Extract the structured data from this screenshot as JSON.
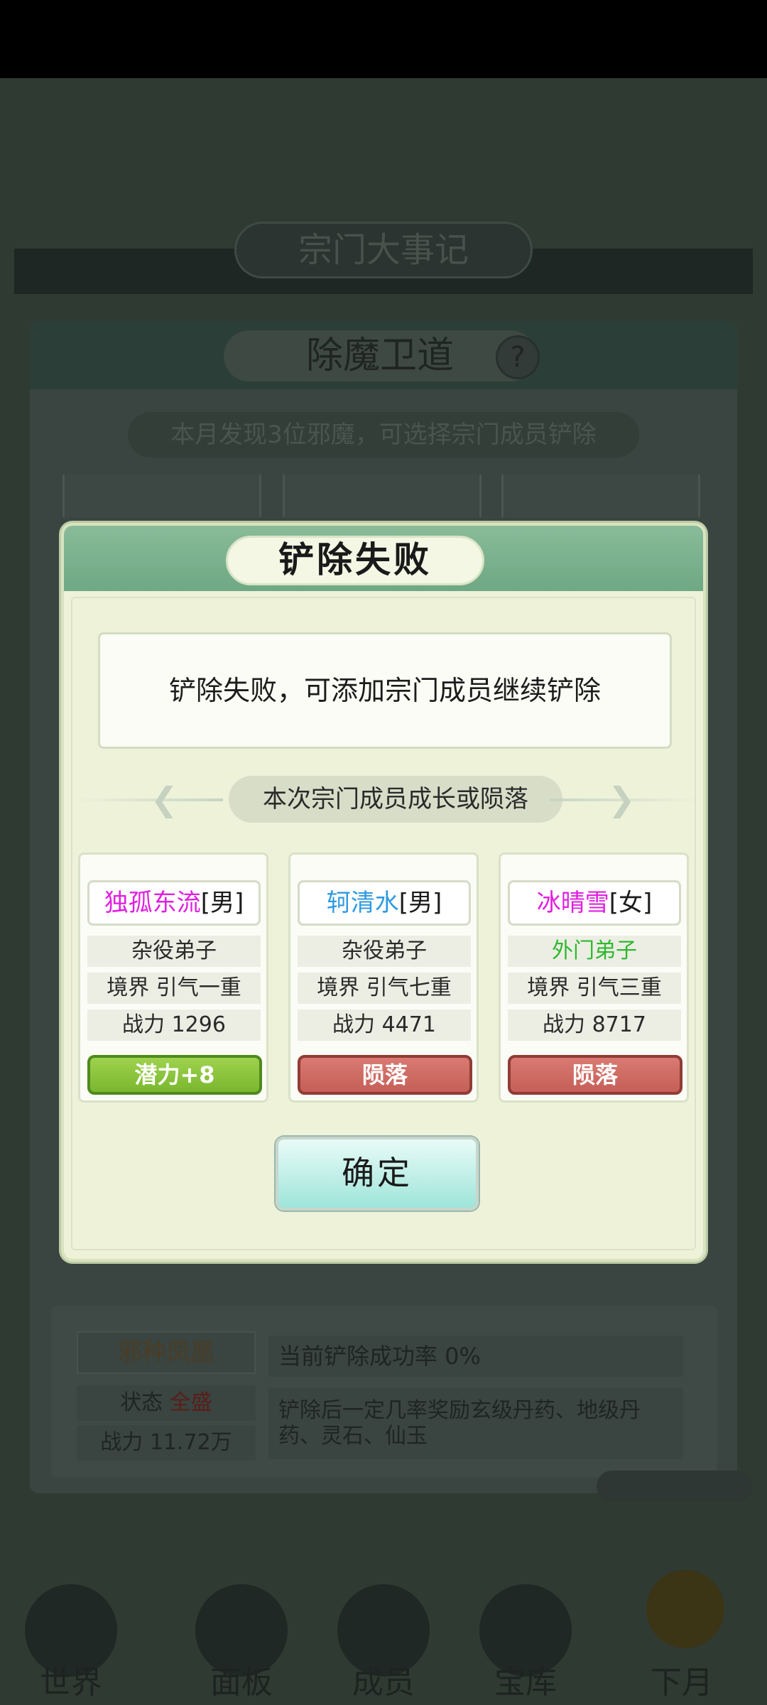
{
  "background": {
    "header_title": "宗门大事记",
    "panel_title": "除魔卫道",
    "help_label": "?",
    "subtitle": "本月发现3位邪魔，可选择宗门成员铲除",
    "evil": {
      "name": "邪种凤凰",
      "state_label": "状态",
      "state_value": "全盛",
      "power": "战力 11.72万"
    },
    "success_rate": "当前铲除成功率 0%",
    "reward_text": "铲除后一定几率奖励玄级丹药、地级丹药、灵石、仙玉",
    "nav": [
      "世界",
      "面板",
      "成员",
      "宝库",
      "下月"
    ]
  },
  "dialog": {
    "title": "铲除失败",
    "message": "铲除失败，可添加宗门成员继续铲除",
    "section_label": "本次宗门成员成长或陨落",
    "confirm_label": "确定",
    "members": [
      {
        "name": "独孤东流",
        "gender": "[男]",
        "name_color": "#e020e0",
        "rank": "杂役弟子",
        "rank_color": "#2a2a2a",
        "realm": "境界 引气一重",
        "power": "战力 1296",
        "result": "潜力+8",
        "result_type": "growth"
      },
      {
        "name": "轲清水",
        "gender": "[男]",
        "name_color": "#2f9ae0",
        "rank": "杂役弟子",
        "rank_color": "#2a2a2a",
        "realm": "境界 引气七重",
        "power": "战力 4471",
        "result": "陨落",
        "result_type": "fall"
      },
      {
        "name": "冰晴雪",
        "gender": "[女]",
        "name_color": "#e020e0",
        "rank": "外门弟子",
        "rank_color": "#2fb82f",
        "realm": "境界 引气三重",
        "power": "战力 8717",
        "result": "陨落",
        "result_type": "fall"
      }
    ]
  },
  "colors": {
    "dialog_bg": "#eef2d9",
    "header_green": "#6ea884",
    "growth_button": "#7ab72f",
    "fall_button": "#c55f57",
    "confirm_button": "#9ee5da"
  }
}
